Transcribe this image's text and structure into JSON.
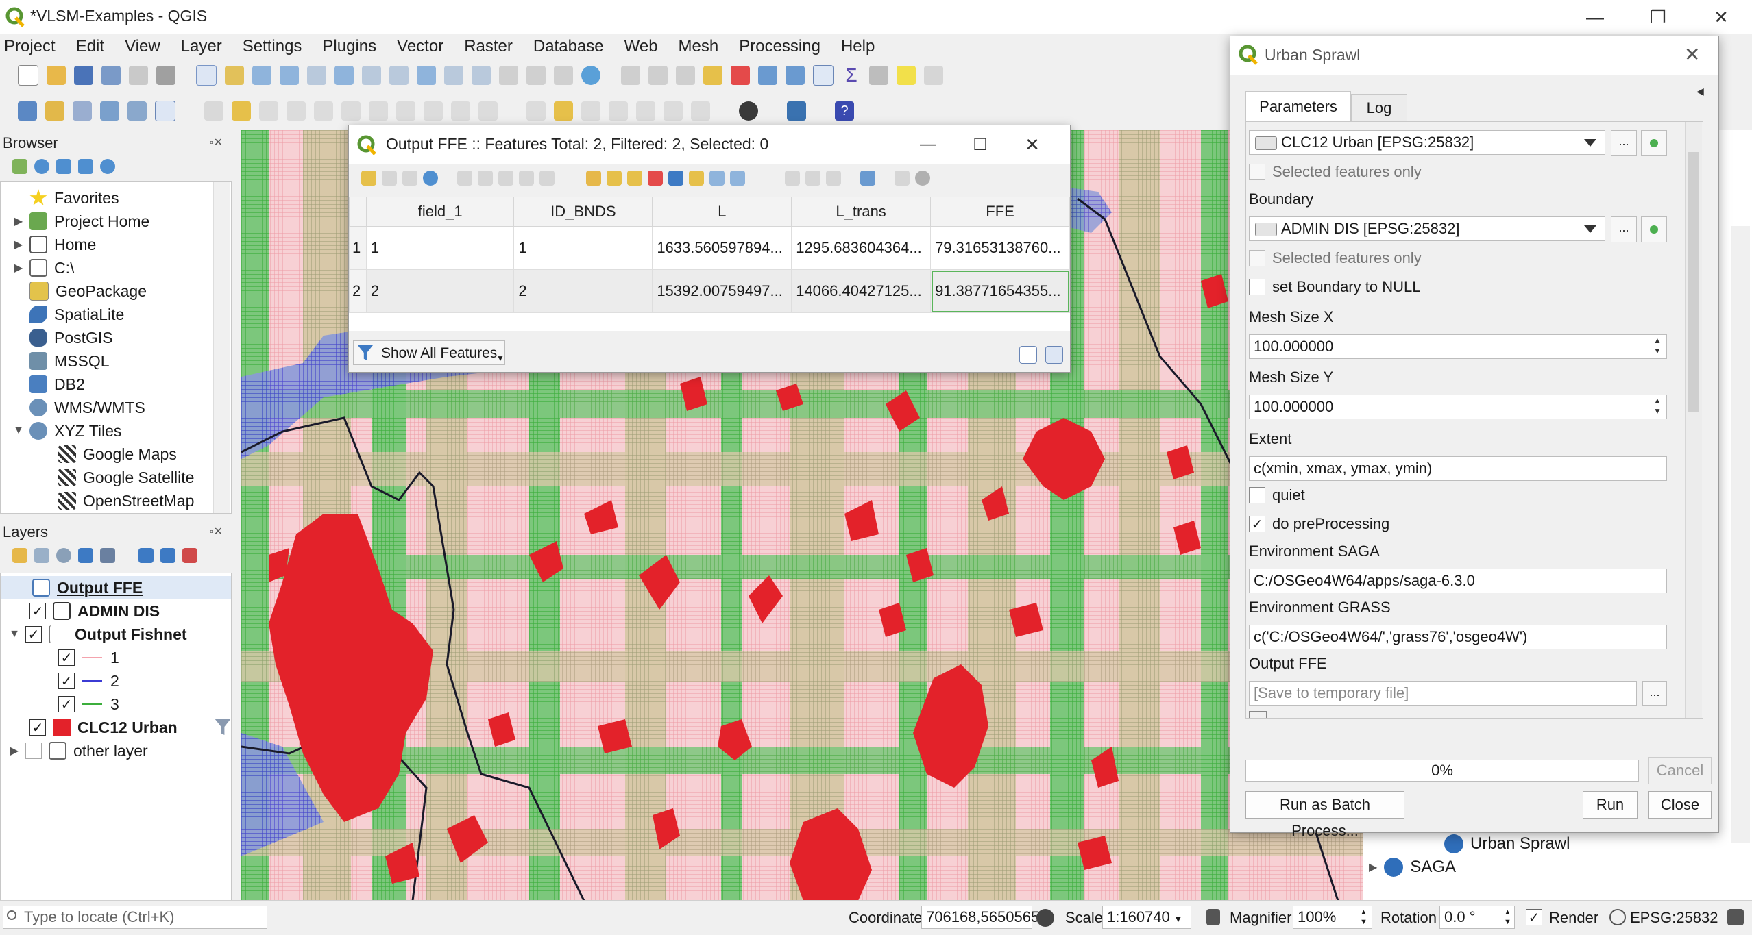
{
  "window": {
    "title": "*VLSM-Examples - QGIS",
    "minimize": "—",
    "restore": "❐",
    "close": "✕"
  },
  "menu": [
    "Project",
    "Edit",
    "View",
    "Layer",
    "Settings",
    "Plugins",
    "Vector",
    "Raster",
    "Database",
    "Web",
    "Mesh",
    "Processing",
    "Help"
  ],
  "browser": {
    "title": "Browser",
    "items": [
      {
        "label": "Favorites",
        "icon": "star-icon",
        "arrow": ""
      },
      {
        "label": "Project Home",
        "icon": "project-home-icon",
        "arrow": "▶"
      },
      {
        "label": "Home",
        "icon": "home-folder-icon",
        "arrow": "▶"
      },
      {
        "label": "C:\\",
        "icon": "drive-icon",
        "arrow": "▶"
      },
      {
        "label": "GeoPackage",
        "icon": "geopackage-icon",
        "arrow": ""
      },
      {
        "label": "SpatiaLite",
        "icon": "spatialite-icon",
        "arrow": ""
      },
      {
        "label": "PostGIS",
        "icon": "postgis-icon",
        "arrow": ""
      },
      {
        "label": "MSSQL",
        "icon": "mssql-icon",
        "arrow": ""
      },
      {
        "label": "DB2",
        "icon": "db2-icon",
        "arrow": ""
      },
      {
        "label": "WMS/WMTS",
        "icon": "wms-icon",
        "arrow": ""
      },
      {
        "label": "XYZ Tiles",
        "icon": "xyz-icon",
        "arrow": "▼"
      },
      {
        "label": "Google Maps",
        "icon": "tile-icon",
        "arrow": ""
      },
      {
        "label": "Google Satellite",
        "icon": "tile-icon",
        "arrow": ""
      },
      {
        "label": "OpenStreetMap",
        "icon": "tile-icon",
        "arrow": ""
      }
    ]
  },
  "layers": {
    "title": "Layers",
    "items": [
      {
        "label": "Output FFE",
        "checked": false,
        "bold": true,
        "underline": true
      },
      {
        "label": "ADMIN DIS",
        "checked": true,
        "bold": true
      },
      {
        "label": "Output Fishnet",
        "checked": true,
        "bold": true
      },
      {
        "label": "1",
        "checked": true,
        "color": "#f4a3ad"
      },
      {
        "label": "2",
        "checked": true,
        "color": "#3b3bd4"
      },
      {
        "label": "3",
        "checked": true,
        "color": "#3cae3c"
      },
      {
        "label": "CLC12 Urban",
        "checked": true,
        "bold": true,
        "color": "#e3222a"
      },
      {
        "label": "other layer",
        "checked": false
      }
    ]
  },
  "attribute_table": {
    "title": "Output FFE :: Features Total: 2, Filtered: 2, Selected: 0",
    "columns": [
      "field_1",
      "ID_BNDS",
      "L",
      "L_trans",
      "FFE"
    ],
    "rows": [
      {
        "num": "1",
        "cells": [
          "1",
          "1",
          "1633.560597894...",
          "1295.683604364...",
          "79.31653138760..."
        ]
      },
      {
        "num": "2",
        "cells": [
          "2",
          "2",
          "15392.00759497...",
          "14066.40427125...",
          "91.38771654355..."
        ]
      }
    ],
    "show_all": "Show All Features"
  },
  "urban_sprawl": {
    "title": "Urban Sprawl",
    "tabs": [
      "Parameters",
      "Log"
    ],
    "input_layer": "CLC12 Urban [EPSG:25832]",
    "selected_only_1": "Selected features only",
    "boundary_label": "Boundary",
    "boundary_layer": "ADMIN DIS [EPSG:25832]",
    "selected_only_2": "Selected features only",
    "set_boundary_null": "set Boundary to NULL",
    "mesh_x_label": "Mesh Size X",
    "mesh_x": "100.000000",
    "mesh_y_label": "Mesh Size Y",
    "mesh_y": "100.000000",
    "extent_label": "Extent",
    "extent": "c(xmin, xmax, ymax, ymin)",
    "quiet": "quiet",
    "do_preprocessing": "do preProcessing",
    "env_saga_label": "Environment SAGA",
    "env_saga": "C:/OSGeo4W64/apps/saga-6.3.0",
    "env_grass_label": "Environment GRASS",
    "env_grass": "c('C:/OSGeo4W64/','grass76','osgeo4W')",
    "output_ffe_label": "Output FFE",
    "output_ffe_placeholder": "[Save to temporary file]",
    "ellipsis": "...",
    "progress": "0%",
    "progress_value": 0,
    "cancel": "Cancel",
    "batch": "Run as Batch Process...",
    "run": "Run",
    "close": "Close"
  },
  "toolbox": {
    "item1": "Urban Sprawl",
    "item2": "SAGA"
  },
  "status": {
    "locate_placeholder": "Type to locate (Ctrl+K)",
    "coordinate_label": "Coordinate",
    "coordinate": "706168,5650565",
    "scale_label": "Scale",
    "scale": "1:160740",
    "magnifier_label": "Magnifier",
    "magnifier": "100%",
    "rotation_label": "Rotation",
    "rotation": "0.0 °",
    "render": "Render",
    "crs": "EPSG:25832"
  }
}
